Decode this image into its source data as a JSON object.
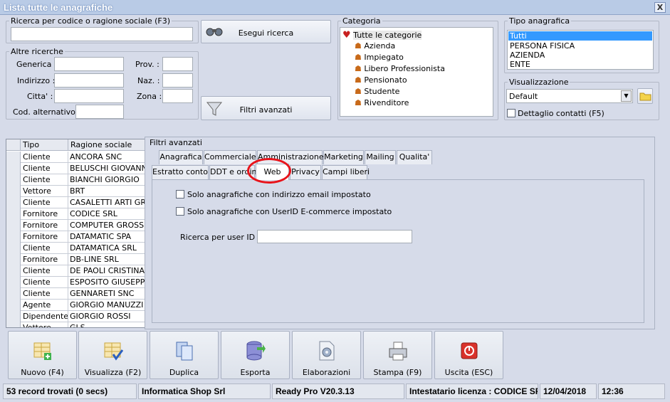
{
  "window": {
    "title": "Lista tutte le anagrafiche",
    "close": "X"
  },
  "search": {
    "legend": "Ricerca per codice o ragione sociale (F3)",
    "value": "",
    "button": "Esegui ricerca"
  },
  "altre": {
    "legend": "Altre ricerche",
    "generica": "Generica :",
    "indirizzo": "Indirizzo :",
    "citta": "Citta' :",
    "cod_alt": "Cod. alternativo :",
    "prov": "Prov. :",
    "naz": "Naz. :",
    "zona": "Zona :"
  },
  "filtri_button": "Filtri avanzati",
  "categoria": {
    "legend": "Categoria",
    "items": [
      "Tutte le categorie",
      "Azienda",
      "Impiegato",
      "Libero Professionista",
      "Pensionato",
      "Studente",
      "Rivenditore"
    ]
  },
  "tipo": {
    "legend": "Tipo anagrafica",
    "items": [
      "Tutti",
      "PERSONA FISICA",
      "AZIENDA",
      "ENTE"
    ]
  },
  "visual": {
    "legend": "Visualizzazione",
    "value": "Default",
    "dettaglio": "Dettaglio contatti (F5)"
  },
  "grid": {
    "headers": [
      "Tipo",
      "Ragione sociale"
    ],
    "rows": [
      [
        "Cliente",
        "ANCORA SNC"
      ],
      [
        "Cliente",
        "BELUSCHI GIOVANNI"
      ],
      [
        "Cliente",
        "BIANCHI GIORGIO"
      ],
      [
        "Vettore",
        "BRT"
      ],
      [
        "Cliente",
        "CASALETTI ARTI GRA"
      ],
      [
        "Fornitore",
        "CODICE SRL"
      ],
      [
        "Fornitore",
        "COMPUTER GROSS SP"
      ],
      [
        "Fornitore",
        "DATAMATIC SPA"
      ],
      [
        "Cliente",
        "DATAMATICA SRL"
      ],
      [
        "Fornitore",
        "DB-LINE SRL"
      ],
      [
        "Cliente",
        "DE PAOLI CRISTINA"
      ],
      [
        "Cliente",
        "ESPOSITO GIUSEPPE"
      ],
      [
        "Cliente",
        "GENNARETI SNC"
      ],
      [
        "Agente",
        "GIORGIO MANUZZI (C"
      ],
      [
        "Dipendente",
        "GIORGIO ROSSI"
      ],
      [
        "Vettore",
        "GLS"
      ]
    ]
  },
  "adv": {
    "legend": "Filtri avanzati",
    "tabs_row1": [
      "Anagrafica",
      "Commerciale",
      "Amministrazione",
      "Marketing",
      "Mailing",
      "Qualita'"
    ],
    "tabs_row2": [
      "Estratto conto",
      "DDT e ordini",
      "Web",
      "Privacy",
      "Campi liberi"
    ],
    "opt_email": "Solo anagrafiche con indirizzo email impostato",
    "opt_userid": "Solo anagrafiche con UserID E-commerce impostato",
    "userid_label": "Ricerca per user ID :",
    "userid_value": ""
  },
  "toolbar": [
    {
      "label": "Nuovo (F4)",
      "icon": "new-record-icon"
    },
    {
      "label": "Visualizza (F2)",
      "icon": "view-icon"
    },
    {
      "label": "Duplica",
      "icon": "duplicate-icon"
    },
    {
      "label": "Esporta",
      "icon": "export-icon"
    },
    {
      "label": "Elaborazioni",
      "icon": "processing-icon"
    },
    {
      "label": "Stampa (F9)",
      "icon": "printer-icon"
    },
    {
      "label": "Uscita (ESC)",
      "icon": "exit-icon"
    }
  ],
  "status": {
    "records": "53 record trovati (0 secs)",
    "company": "Informatica Shop Srl",
    "version": "Ready Pro V20.3.13",
    "license": "Intestatario licenza : CODICE SRL",
    "date": "12/04/2018",
    "time": "12:36"
  },
  "colors": {
    "highlight": "#3399ff",
    "annotation": "#e8141b"
  }
}
